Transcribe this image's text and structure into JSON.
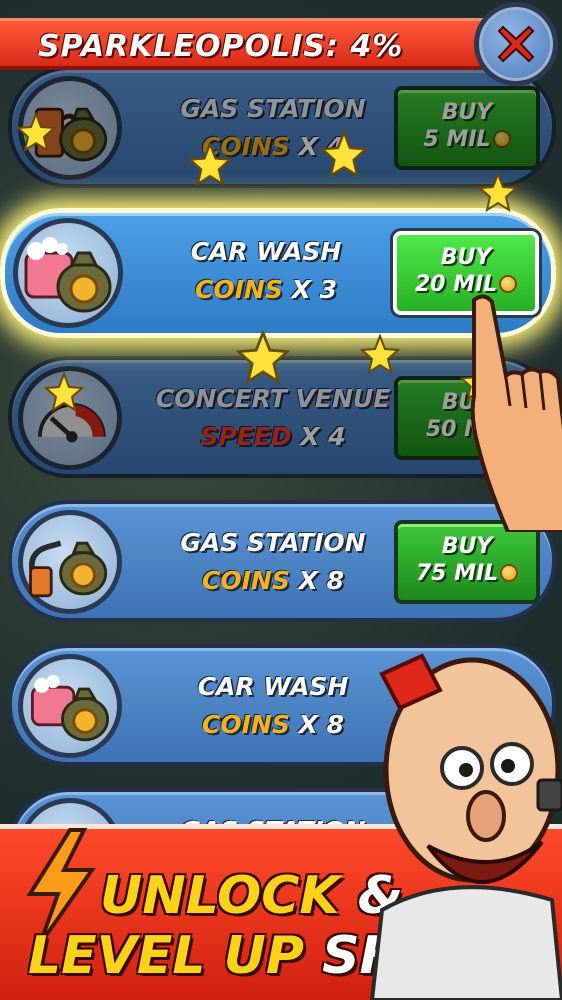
{
  "header": {
    "title": "SPARKLEOPOLIS: 4%"
  },
  "shops": [
    {
      "name": "GAS STATION",
      "bonus_type": "COINS",
      "bonus_multiplier": "X 4",
      "buy_label": "BUY",
      "price": "5 MIL",
      "icon": "gas-pump-coin-bag-icon",
      "state": "dimmed"
    },
    {
      "name": "CAR WASH",
      "bonus_type": "COINS",
      "bonus_multiplier": "X 3",
      "buy_label": "BUY",
      "price": "20 MIL",
      "icon": "car-wash-sponge-coin-bag-icon",
      "state": "highlighted"
    },
    {
      "name": "CONCERT VENUE",
      "bonus_type": "SPEED",
      "bonus_multiplier": "X 4",
      "buy_label": "BUY",
      "price": "50 MIL",
      "icon": "speedometer-icon",
      "state": "dimmed"
    },
    {
      "name": "GAS STATION",
      "bonus_type": "COINS",
      "bonus_multiplier": "X 8",
      "buy_label": "BUY",
      "price": "75 MIL",
      "icon": "gas-pump-coin-bag-icon",
      "state": "dimmed"
    },
    {
      "name": "CAR WASH",
      "bonus_type": "COINS",
      "bonus_multiplier": "X 8",
      "buy_label": "",
      "price": "",
      "icon": "car-wash-sponge-coin-bag-icon",
      "state": "dimmed"
    },
    {
      "name": "GAS STATION",
      "bonus_type": "",
      "bonus_multiplier": "",
      "buy_label": "",
      "price": "",
      "icon": "gas-pump-coin-bag-icon",
      "state": "dimmed"
    }
  ],
  "promo": {
    "line1_yellow": "UNLOCK",
    "line1_white": "&",
    "line2_yellow": "LEVEL UP",
    "line2_white": "SHOPS"
  },
  "colors": {
    "title_bar": "#e0321e",
    "row_blue": "#4a86c8",
    "buy_green": "#2fb02a",
    "coins_text": "#f6b21c",
    "speed_text": "#f03a2a",
    "banner_red": "#e02a14",
    "banner_yellow": "#ffd21a"
  }
}
